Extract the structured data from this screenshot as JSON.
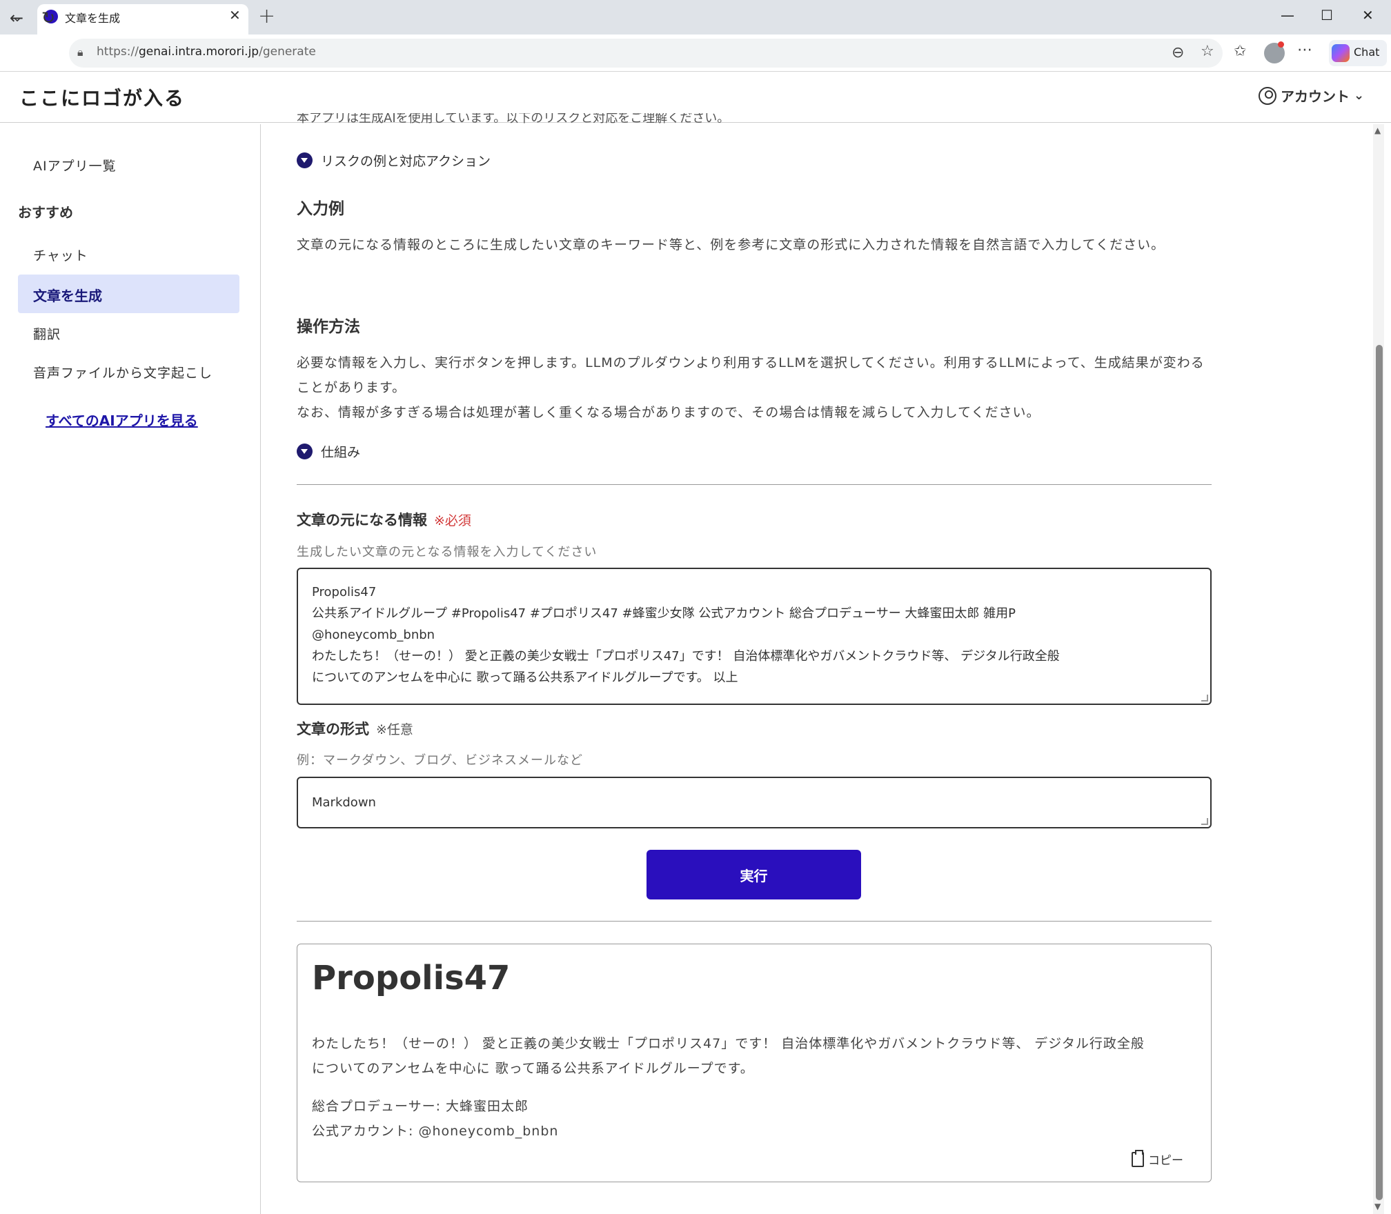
{
  "browser": {
    "tab_title": "文章を生成",
    "url_prefix": "https://",
    "url_host": "genai.intra.morori.jp",
    "url_path": "/generate",
    "chat_label": "Chat"
  },
  "header": {
    "logo": "ここにロゴが入る",
    "account_label": "アカウント"
  },
  "sidebar": {
    "items": [
      {
        "label": "AIアプリ一覧"
      },
      {
        "label": "おすすめ"
      },
      {
        "label": "チャット"
      },
      {
        "label": "文章を生成"
      },
      {
        "label": "翻訳"
      },
      {
        "label": "音声ファイルから文字起こし"
      }
    ],
    "all_apps_link": "すべてのAIアプリを見る"
  },
  "main": {
    "clipped_text": "本アプリは生成AIを使用しています。以下のリスクと対応をご理解ください。",
    "risk_toggle": "リスクの例と対応アクション",
    "input_example_heading": "入力例",
    "input_example_text": "文章の元になる情報のところに生成したい文章のキーワード等と、例を参考に文章の形式に入力された情報を自然言語で入力してください。",
    "how_to_heading": "操作方法",
    "how_to_line1": "必要な情報を入力し、実行ボタンを押します。LLMのプルダウンより利用するLLMを選択してください。利用するLLMによって、生成結果が変わることがあります。",
    "how_to_line2": "なお、情報が多すぎる場合は処理が著しく重くなる場合がありますので、その場合は情報を減らして入力してください。",
    "mechanism_toggle": "仕組み",
    "source_label": "文章の元になる情報",
    "source_required": "※必須",
    "source_hint": "生成したい文章の元となる情報を入力してください",
    "source_lines": [
      "Propolis47",
      "公共系アイドルグループ #Propolis47 #プロポリス47 #蜂蜜少女隊 公式アカウント 総合プロデューサー 大蜂蜜田太郎 雑用P",
      "@honeycomb_bnbn",
      "わたしたち！（せーの！） 愛と正義の美少女戦士「プロポリス47」です！ 自治体標準化やガバメントクラウド等、 デジタル行政全般",
      "についてのアンセムを中心に 歌って踊る公共系アイドルグループです。 以上"
    ],
    "format_label": "文章の形式",
    "format_optional": "※任意",
    "format_hint": "例：マークダウン、ブログ、ビジネスメールなど",
    "format_value": "Markdown",
    "run_button": "実行",
    "result": {
      "title": "Propolis47",
      "para_line1": "わたしたち！（せーの！） 愛と正義の美少女戦士「プロポリス47」です！ 自治体標準化やガバメントクラウド等、 デジタル行政全般",
      "para_line2": "についてのアンセムを中心に 歌って踊る公共系アイドルグループです。",
      "producer": "総合プロデューサー: 大蜂蜜田太郎",
      "account": "公式アカウント: @honeycomb_bnbn",
      "copy_label": "コピー"
    }
  },
  "colors": {
    "primary": "#2a0fbd",
    "sidebar_active_bg": "#dde3fb",
    "required_red": "#d23a3a",
    "link_blue": "#1e16a8"
  }
}
